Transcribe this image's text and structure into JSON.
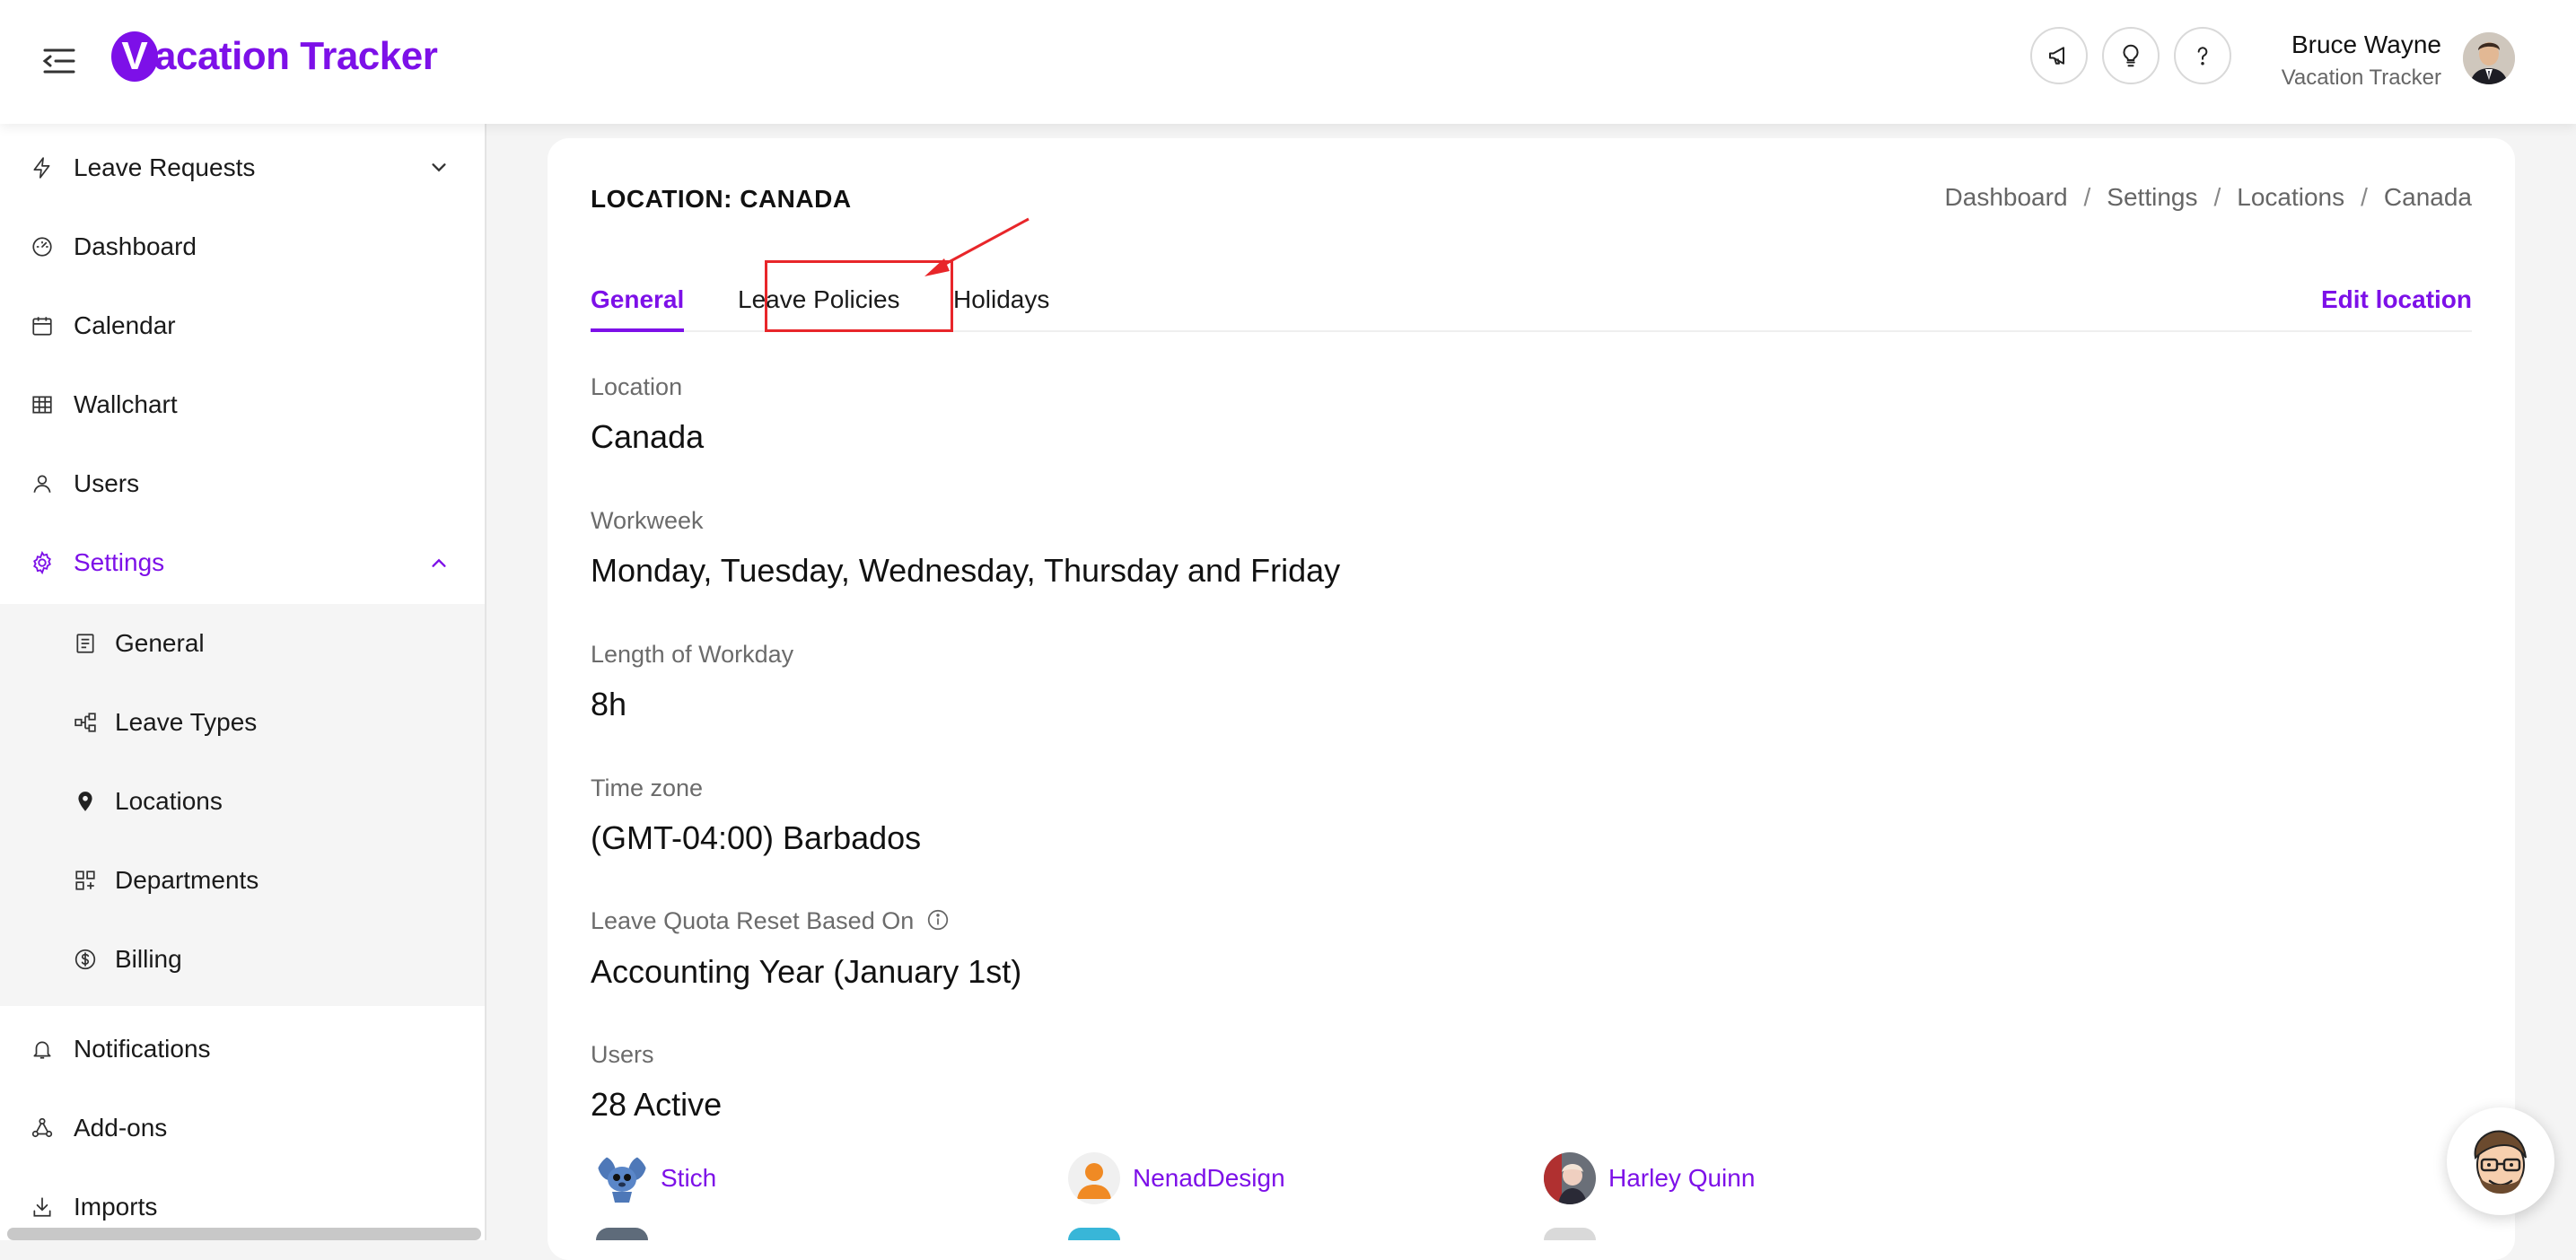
{
  "header": {
    "logo_mark": "V",
    "logo_text": "acation Tracker",
    "user_name": "Bruce Wayne",
    "user_org": "Vacation Tracker"
  },
  "sidebar": {
    "items": [
      {
        "label": "Leave Requests",
        "icon": "lightning-icon"
      },
      {
        "label": "Dashboard",
        "icon": "gauge-icon"
      },
      {
        "label": "Calendar",
        "icon": "calendar-icon"
      },
      {
        "label": "Wallchart",
        "icon": "table-icon"
      },
      {
        "label": "Users",
        "icon": "user-icon"
      },
      {
        "label": "Settings",
        "icon": "gear-icon"
      }
    ],
    "sub_items": [
      {
        "label": "General",
        "icon": "document-icon"
      },
      {
        "label": "Leave Types",
        "icon": "nodes-icon"
      },
      {
        "label": "Locations",
        "icon": "map-pin-icon"
      },
      {
        "label": "Departments",
        "icon": "grid-plus-icon"
      },
      {
        "label": "Billing",
        "icon": "dollar-icon"
      }
    ],
    "bottom_items": [
      {
        "label": "Notifications",
        "icon": "bell-icon"
      },
      {
        "label": "Add-ons",
        "icon": "integrations-icon"
      },
      {
        "label": "Imports",
        "icon": "import-icon"
      }
    ]
  },
  "page": {
    "title": "LOCATION: CANADA",
    "breadcrumb": [
      "Dashboard",
      "Settings",
      "Locations",
      "Canada"
    ],
    "tabs": [
      "General",
      "Leave Policies",
      "Holidays"
    ],
    "edit_label": "Edit location"
  },
  "fields": [
    {
      "label": "Location",
      "value": "Canada"
    },
    {
      "label": "Workweek",
      "value": "Monday, Tuesday, Wednesday, Thursday and Friday"
    },
    {
      "label": "Length of Workday",
      "value": "8h"
    },
    {
      "label": "Time zone",
      "value": "(GMT-04:00) Barbados"
    },
    {
      "label": "Leave Quota Reset Based On",
      "value": "Accounting Year (January 1st)"
    },
    {
      "label": "Users",
      "value": "28 Active"
    }
  ],
  "users": [
    "Stich",
    "NenadDesign",
    "Harley Quinn"
  ],
  "colors": {
    "accent": "#7d10e8",
    "highlight": "#e8262a"
  }
}
